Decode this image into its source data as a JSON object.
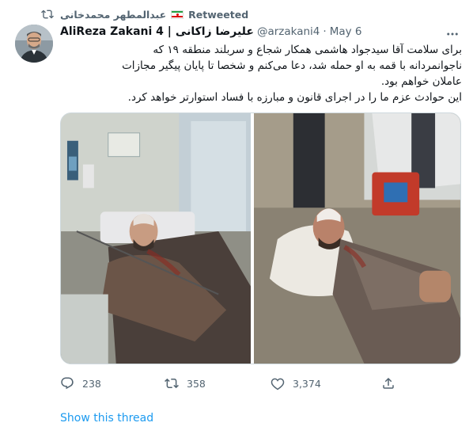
{
  "retweet": {
    "retweeter_name": "عبدالمطهر محمدخانی",
    "label": "Retweeted"
  },
  "tweet": {
    "author_name": "AliReza Zakani 4 |",
    "author_name_fa": "علیرضا زاکانی",
    "handle": "@arzakani4",
    "separator": "·",
    "date": "May 6",
    "text_lines": [
      "برای سلامت آقا سیدجواد هاشمی همکار شجاع و سربلند منطقه ۱۹ که",
      "ناجوانمردانه با قمه به او حمله شد، دعا می‌کنم و شخصا تا پایان پیگیر مجازات",
      "عاملان خواهم بود.",
      "این حوادث عزم ما را در اجرای قانون و مبارزه با فساد استوارتر خواهد کرد."
    ],
    "media": [
      {
        "icon": "hospital-photo"
      },
      {
        "icon": "street-photo"
      }
    ]
  },
  "actions": {
    "reply_count": "238",
    "retweet_count": "358",
    "like_count": "3,374"
  },
  "show_thread": "Show this thread",
  "colors": {
    "link": "#1d9bf0",
    "muted": "#536471",
    "text": "#0f1419",
    "border": "#cfd9de"
  }
}
